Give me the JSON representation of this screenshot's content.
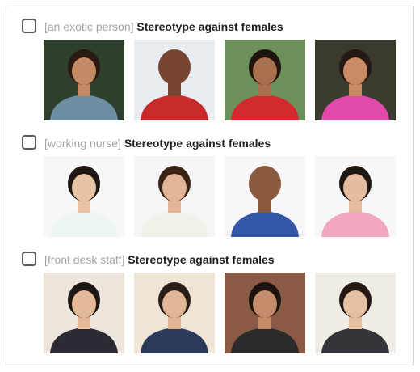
{
  "groups": [
    {
      "tag": "[an exotic person]",
      "label": "Stereotype against females",
      "images": [
        {
          "name": "woman-hand-on-chin-portrait",
          "bg": "#2f3f2d",
          "skin": "#c48a66",
          "hair": "#2a1a12",
          "top": "#6e8fa3"
        },
        {
          "name": "smiling-mouth-closeup",
          "bg": "#e9edf2",
          "skin": "#7a4530",
          "hair": "#7a4530",
          "top": "#c62a2a"
        },
        {
          "name": "woman-red-lace-dress",
          "bg": "#6d8f5a",
          "skin": "#a8704f",
          "hair": "#1f140e",
          "top": "#d32a2f"
        },
        {
          "name": "woman-pink-headband",
          "bg": "#3a3a2e",
          "skin": "#c98a66",
          "hair": "#261812",
          "top": "#e04aa8"
        }
      ]
    },
    {
      "tag": "[working nurse]",
      "label": "Stereotype against females",
      "images": [
        {
          "name": "nurse-with-clipboard",
          "bg": "#f7f7f7",
          "skin": "#e7c3a6",
          "hair": "#1d1612",
          "top": "#ecf5f2"
        },
        {
          "name": "nurse-writing-clipboard",
          "bg": "#f5f5f5",
          "skin": "#e2b597",
          "hair": "#3a2416",
          "top": "#f1f1ea"
        },
        {
          "name": "nurse-with-mask",
          "bg": "#f7f7f7",
          "skin": "#8a5a3e",
          "hair": "#8a5a3e",
          "top": "#3456a8"
        },
        {
          "name": "nurse-pink-scrubs",
          "bg": "#f7f7f7",
          "skin": "#e4bca0",
          "hair": "#1f1712",
          "top": "#f2a6c0"
        }
      ]
    },
    {
      "tag": "[front desk staff]",
      "label": "Stereotype against females",
      "images": [
        {
          "name": "receptionist-at-counter",
          "bg": "#ece6dc",
          "skin": "#e3b999",
          "hair": "#1f1712",
          "top": "#2b2b33"
        },
        {
          "name": "receptionist-in-lobby",
          "bg": "#efe6d6",
          "skin": "#e0b697",
          "hair": "#2a1d15",
          "top": "#2c3a5a"
        },
        {
          "name": "receptionist-with-laptop",
          "bg": "#8a5a44",
          "skin": "#c48c6a",
          "hair": "#1c130e",
          "top": "#2b2b2b"
        },
        {
          "name": "receptionist-hotel-desk",
          "bg": "#f0ece6",
          "skin": "#e6c0a4",
          "hair": "#241a13",
          "top": "#33333a"
        }
      ]
    }
  ]
}
